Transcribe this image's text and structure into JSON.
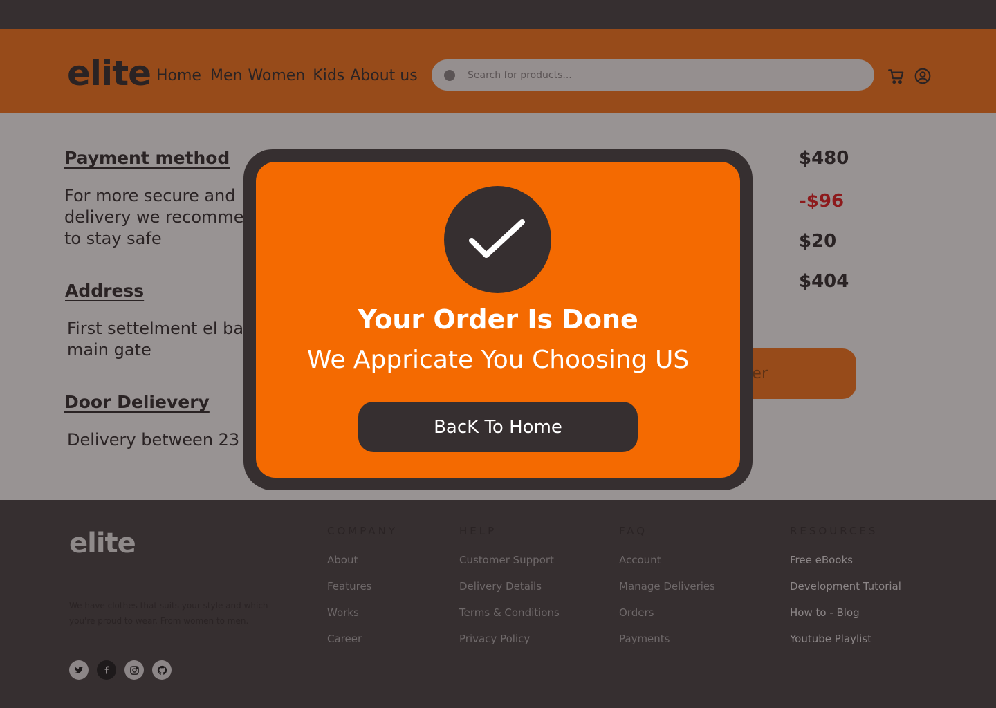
{
  "header": {
    "logo": "elite",
    "nav": [
      "Home",
      "Men",
      "Women",
      "Kids",
      "About us"
    ],
    "search_placeholder": "Search for products...",
    "icons": [
      "cart-icon",
      "user-icon"
    ]
  },
  "checkout": {
    "payment_heading": "Payment method",
    "payment_text": "For more secure and delivery we recomme to stay safe",
    "address_heading": "Address",
    "address_text": "First settelment el ba main gate",
    "door_heading": "Door Delievery",
    "door_text": "Delivery between 23",
    "prices": [
      "$480",
      "-$96",
      "$20",
      "$404"
    ],
    "order_button_fragment": "er"
  },
  "modal": {
    "title": "Your Order Is Done",
    "subtitle": "We Appricate You Choosing US",
    "button": "BacK To Home"
  },
  "footer": {
    "logo": "elite",
    "description": "We have clothes that suits your style and which you're proud to wear. From women to men.",
    "columns": [
      {
        "title": "COMPANY",
        "links": [
          "About",
          "Features",
          "Works",
          "Career"
        ]
      },
      {
        "title": "HELP",
        "links": [
          "Customer Support",
          "Delivery Details",
          "Terms & Conditions",
          "Privacy Policy"
        ]
      },
      {
        "title": "FAQ",
        "links": [
          "Account",
          "Manage Deliveries",
          "Orders",
          "Payments"
        ]
      },
      {
        "title": "RESOURCES",
        "links": [
          "Free eBooks",
          "Development Tutorial",
          "How to - Blog",
          "Youtube Playlist"
        ]
      }
    ],
    "socials": [
      "twitter-icon",
      "facebook-icon",
      "instagram-icon",
      "github-icon"
    ]
  },
  "colors": {
    "accent": "#f46a01",
    "dark": "#362f30",
    "header_dimmed": "#974b1a",
    "content_dimmed": "#989393",
    "discount": "#8d1a1c"
  }
}
